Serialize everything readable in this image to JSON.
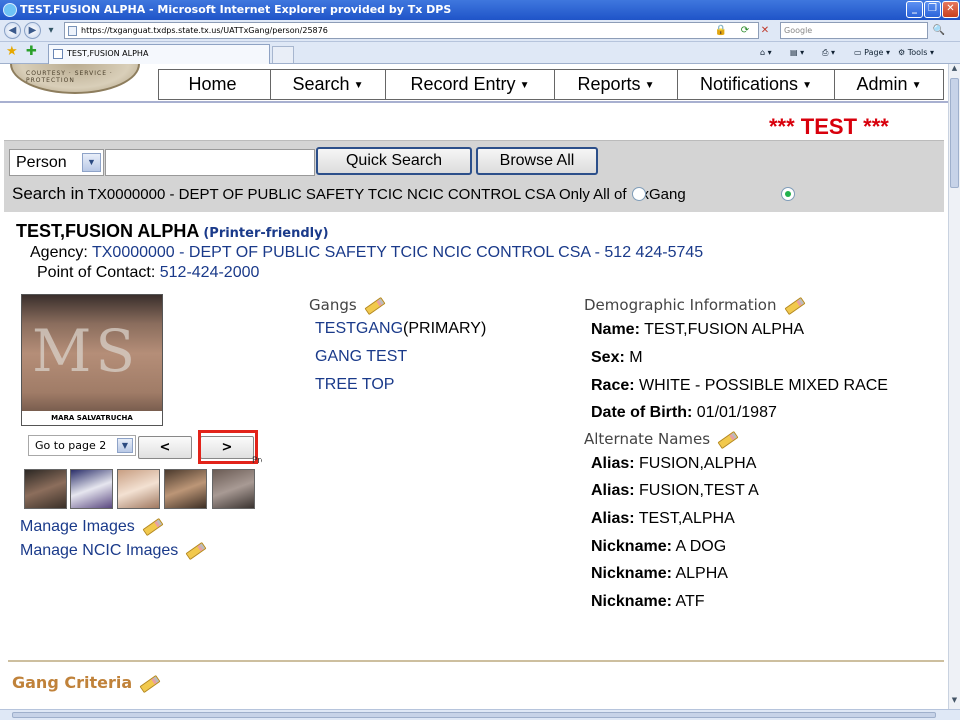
{
  "window": {
    "title": "TEST,FUSION ALPHA - Microsoft Internet Explorer provided by Tx DPS",
    "url": "https://txganguat.txdps.state.tx.us/UATTxGang/person/25876",
    "search_placeholder": "Google",
    "tab_title": "TEST,FUSION ALPHA",
    "tools": {
      "page": "Page",
      "tools": "Tools"
    }
  },
  "nav": [
    {
      "label": "Home",
      "caret": ""
    },
    {
      "label": "Search",
      "caret": "▼"
    },
    {
      "label": "Record Entry",
      "caret": "▼"
    },
    {
      "label": "Reports",
      "caret": "▼"
    },
    {
      "label": "Notifications",
      "caret": "▼"
    },
    {
      "label": "Admin",
      "caret": "▼"
    }
  ],
  "banner": "*** TEST ***",
  "search": {
    "type": "Person",
    "query": "",
    "quick_search": "Quick Search",
    "browse_all": "Browse All",
    "search_in_label": "Search in",
    "search_in_scope": "TX0000000  - DEPT OF PUBLIC SAFETY TCIC NCIC CONTROL CSA Only All of",
    "search_in_suffix": "xGang"
  },
  "person": {
    "name": "TEST,FUSION ALPHA",
    "printer_friendly": "(Printer-friendly)",
    "agency_label": "Agency:",
    "agency_value": "TX0000000 - DEPT OF PUBLIC SAFETY TCIC NCIC CONTROL CSA - 512 424-5745",
    "poc_label": "Point of Contact:",
    "poc_value": "512-424-2000"
  },
  "images": {
    "caption": "MARA SALVATRUCHA",
    "photo_text": "MS",
    "goto_page": "Go to page 2",
    "prev_label": "<",
    "next_label": ">",
    "prev_text": "Pre",
    "manage_images": "Manage Images",
    "manage_ncic_images": "Manage NCIC Images"
  },
  "gangs": {
    "header": "Gangs",
    "items": [
      {
        "name": "TESTGANG",
        "suffix": "(PRIMARY)"
      },
      {
        "name": "GANG TEST",
        "suffix": ""
      },
      {
        "name": "TREE TOP",
        "suffix": ""
      }
    ]
  },
  "demographics": {
    "header": "Demographic  Information",
    "name_label": "Name:",
    "name_value": "TEST,FUSION ALPHA",
    "sex_label": "Sex:",
    "sex_value": "M",
    "race_label": "Race:",
    "race_value": "WHITE - POSSIBLE MIXED RACE",
    "dob_label": "Date of Birth:",
    "dob_value": "01/01/1987"
  },
  "alternate_names": {
    "header": "Alternate  Names",
    "entries": [
      {
        "label": "Alias:",
        "value": "FUSION,ALPHA"
      },
      {
        "label": "Alias:",
        "value": "FUSION,TEST A"
      },
      {
        "label": "Alias:",
        "value": "TEST,ALPHA"
      },
      {
        "label": "Nickname:",
        "value": "A DOG"
      },
      {
        "label": "Nickname:",
        "value": "ALPHA"
      },
      {
        "label": "Nickname:",
        "value": "ATF"
      }
    ]
  },
  "gang_criteria": "Gang Criteria",
  "seal_text": "COURTESY · SERVICE · PROTECTION",
  "colors": {
    "link": "#1a3a8a",
    "banner": "#d8000c",
    "highlight": "#e2231a",
    "section": "#c0823a"
  }
}
